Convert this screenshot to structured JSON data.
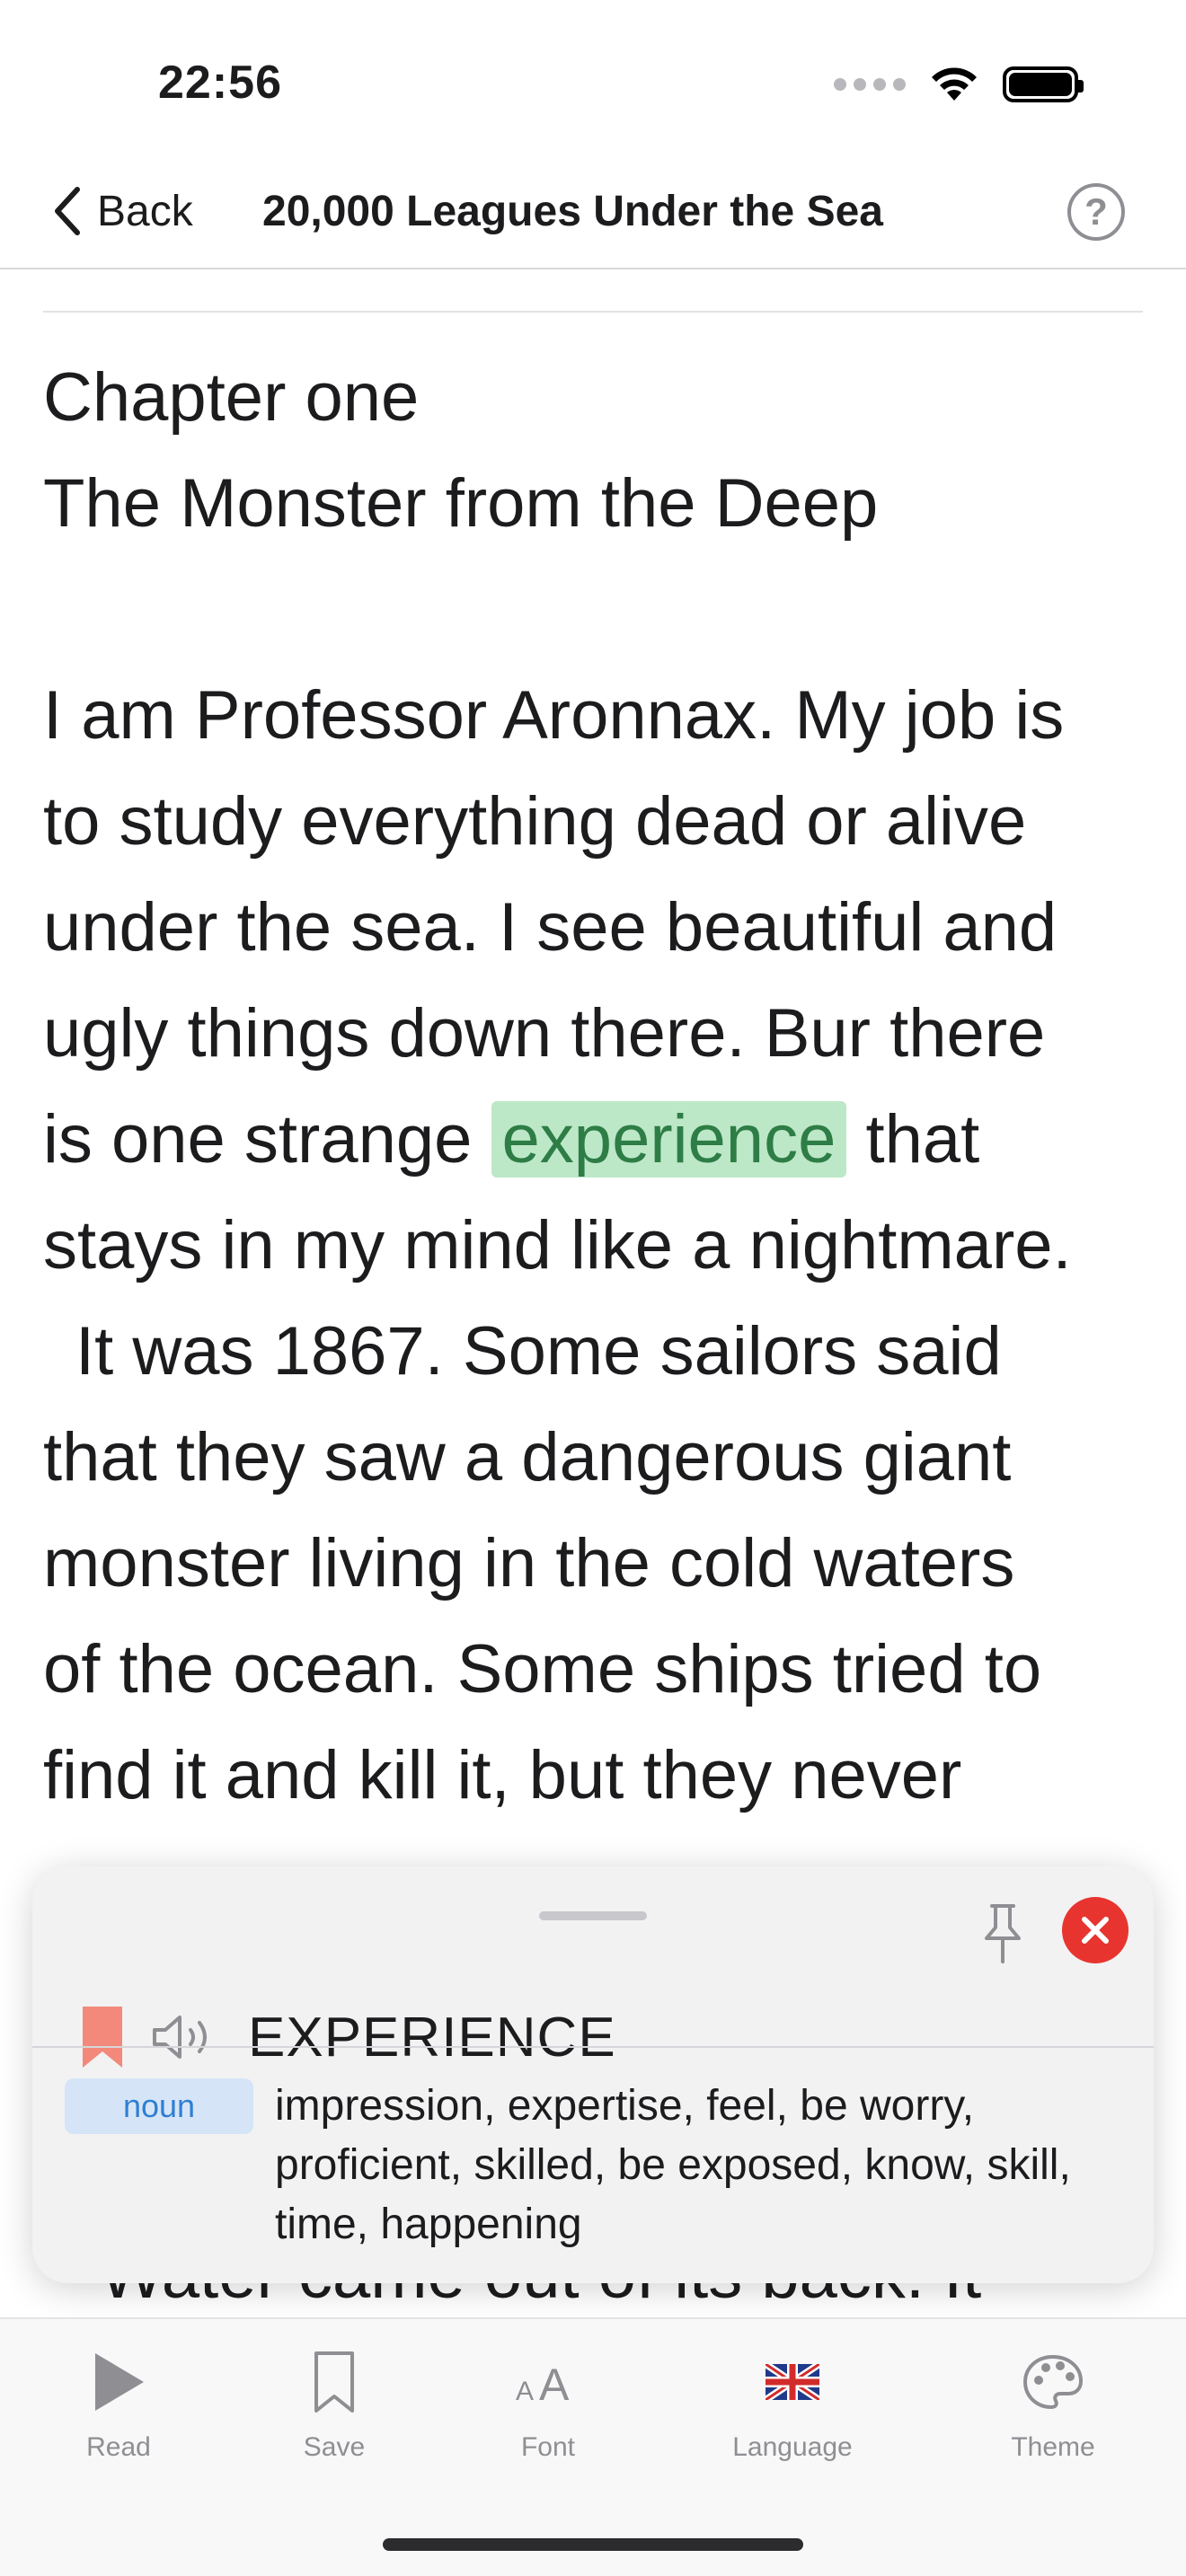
{
  "status_bar": {
    "time": "22:56"
  },
  "nav": {
    "back_label": "Back",
    "title": "20,000 Leagues Under the Sea",
    "help_symbol": "?"
  },
  "reading": {
    "chapter_number": "Chapter one",
    "chapter_title": "The Monster from the Deep",
    "lines": [
      "I am Professor Aronnax. My job is",
      "to study everything dead or alive",
      "under the sea. I see beautiful and",
      "ugly things down there. Bur there"
    ],
    "highlight_before": "is one strange ",
    "highlight_word": "experience",
    "highlight_after": " that",
    "lines_after": [
      "stays in my mind like a nightmare.",
      "It was 1867. Some sailors said",
      "that they saw a dangerous giant",
      "monster living in the cold waters",
      "of the ocean. Some ships tried to",
      "find it and kill it, but they never"
    ],
    "under_popup_line": "\"Water came out of its back. It"
  },
  "popup": {
    "word": "EXPERIENCE",
    "part_of_speech": "noun",
    "synonyms": "impression, expertise, feel, be worry, proficient, skilled, be exposed, know, skill, time, happening",
    "colors": {
      "bookmark": "#f2897a",
      "close": "#e8342f",
      "badge_bg": "#d5e5f7",
      "badge_text": "#2f7fd3"
    }
  },
  "tab_bar": {
    "tabs": [
      {
        "label": "Read",
        "icon": "play-icon"
      },
      {
        "label": "Save",
        "icon": "bookmark-icon"
      },
      {
        "label": "Font",
        "icon": "font-size-icon"
      },
      {
        "label": "Language",
        "icon": "uk-flag-icon"
      },
      {
        "label": "Theme",
        "icon": "palette-icon"
      }
    ]
  },
  "colors": {
    "highlight_bg": "#bde8c8",
    "highlight_text": "#2e7d46"
  }
}
